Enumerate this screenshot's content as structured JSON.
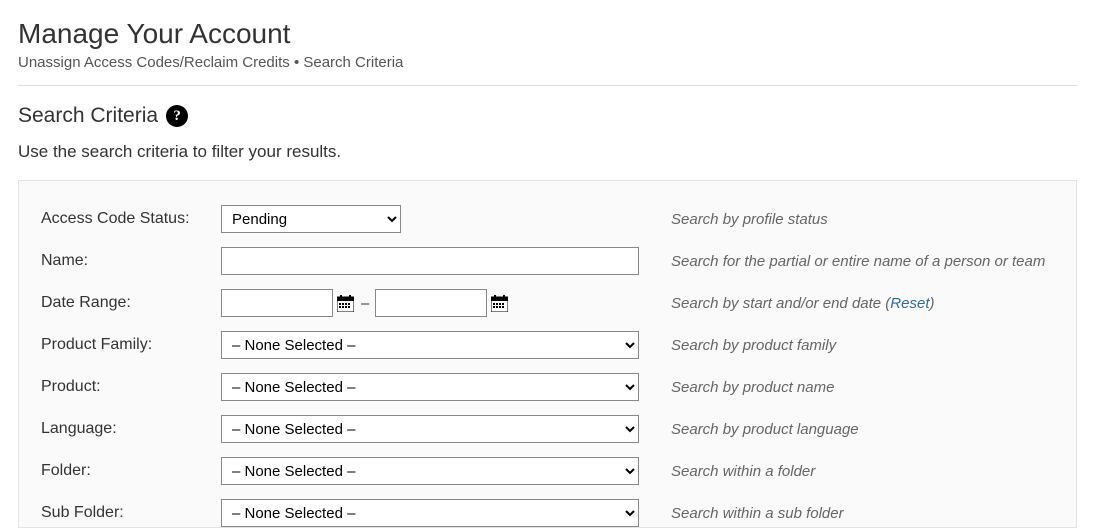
{
  "header": {
    "title": "Manage Your Account",
    "breadcrumb": "Unassign Access Codes/Reclaim Credits • Search Criteria"
  },
  "section": {
    "title": "Search Criteria",
    "description": "Use the search criteria to filter your results."
  },
  "form": {
    "access_code_status": {
      "label": "Access Code Status:",
      "value": "Pending",
      "hint": "Search by profile status"
    },
    "name": {
      "label": "Name:",
      "value": "",
      "hint": "Search for the partial or entire name of a person or team"
    },
    "date_range": {
      "label": "Date Range:",
      "start": "",
      "end": "",
      "sep": "–",
      "hint_prefix": "Search by start and/or end date  (",
      "reset": "Reset",
      "hint_suffix": ")"
    },
    "product_family": {
      "label": "Product Family:",
      "value": "– None Selected –",
      "hint": "Search by product family"
    },
    "product": {
      "label": "Product:",
      "value": "– None Selected –",
      "hint": "Search by product name"
    },
    "language": {
      "label": "Language:",
      "value": "– None Selected –",
      "hint": "Search by product language"
    },
    "folder": {
      "label": "Folder:",
      "value": "– None Selected –",
      "hint": "Search within a folder"
    },
    "sub_folder": {
      "label": "Sub Folder:",
      "value": "– None Selected –",
      "hint": "Search within a sub folder"
    }
  }
}
